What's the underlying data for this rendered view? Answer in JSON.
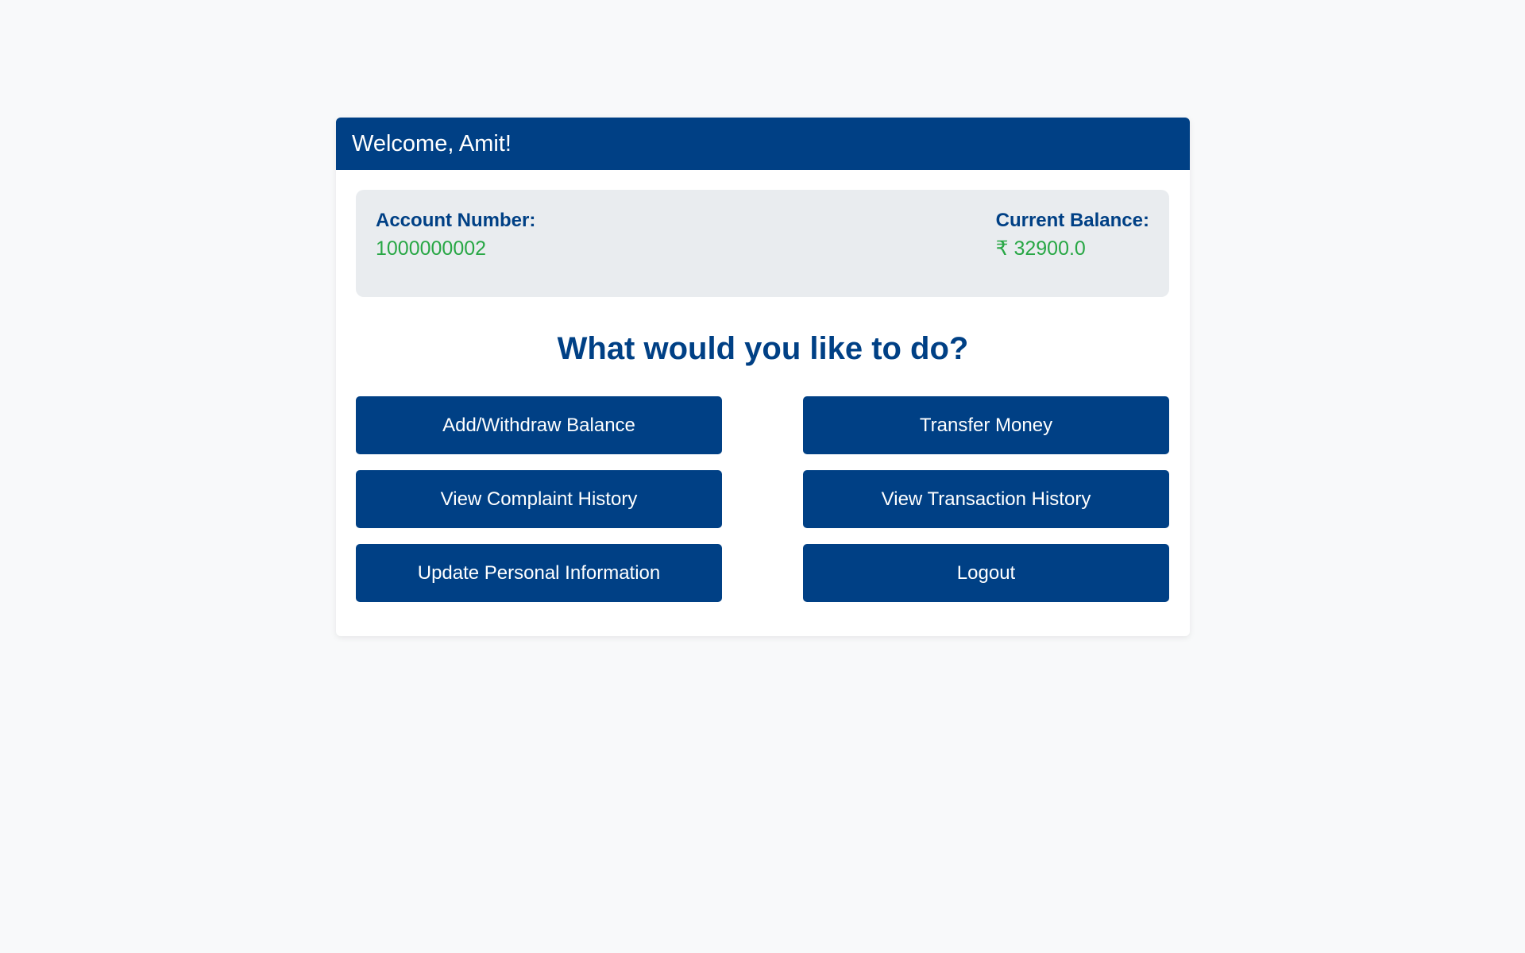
{
  "header": {
    "welcome": "Welcome, Amit!"
  },
  "account": {
    "number_label": "Account Number:",
    "number_value": "1000000002",
    "balance_label": "Current Balance:",
    "balance_value": "₹ 32900.0"
  },
  "prompt": "What would you like to do?",
  "actions": [
    {
      "label": "Add/Withdraw Balance"
    },
    {
      "label": "Transfer Money"
    },
    {
      "label": "View Complaint History"
    },
    {
      "label": "View Transaction History"
    },
    {
      "label": "Update Personal Information"
    },
    {
      "label": "Logout"
    }
  ],
  "colors": {
    "primary": "#004085",
    "success": "#28a745",
    "info_bg": "#e9ecef",
    "page_bg": "#f8f9fa"
  }
}
